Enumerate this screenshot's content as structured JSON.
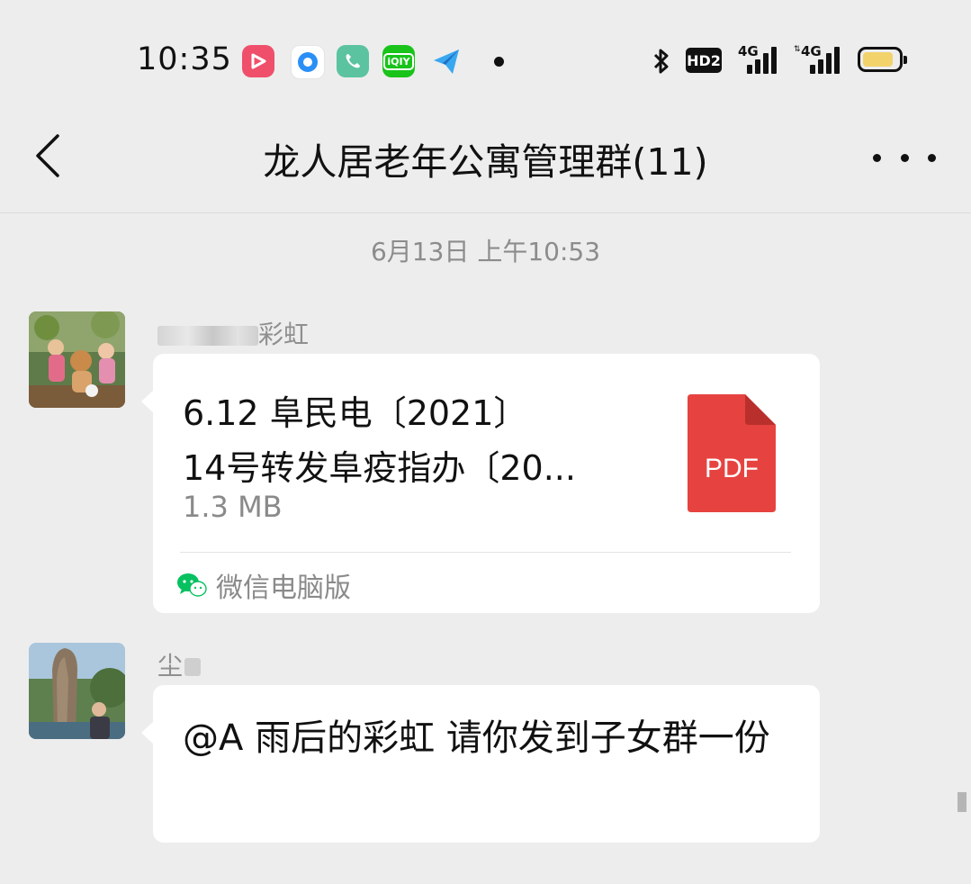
{
  "status_bar": {
    "time": "10:35",
    "apps": [
      {
        "icon": "video-app-icon",
        "color": "#ef4f6a",
        "glyph": "▶"
      },
      {
        "icon": "browser-app-icon",
        "color": "#ffffff",
        "glyph": ""
      },
      {
        "icon": "phone-app-icon",
        "color": "#5bc3a0",
        "glyph": "✆"
      },
      {
        "icon": "iqiyi-app-icon",
        "color": "#19c31a",
        "glyph": "iQIY"
      },
      {
        "icon": "paper-plane-app-icon",
        "color": "#38a7f0",
        "glyph": ""
      }
    ],
    "hd_label": "HD2",
    "signal1_label": "4G",
    "signal2_label": "4G",
    "battery_color": "#f2d36b"
  },
  "header": {
    "back_icon": "chevron-left-icon",
    "title": "龙人居老年公寓管理群(11)",
    "more_icon": "ellipsis-icon"
  },
  "chat": {
    "timestamp": "6月13日 上午10:53",
    "messages": [
      {
        "type": "file",
        "sender": "彩虹",
        "file_name_line1": "6.12 阜民电〔2021〕",
        "file_name_line2": "14号转发阜疫指办〔20...",
        "file_size": "1.3 MB",
        "file_icon_label": "PDF",
        "source": "微信电脑版"
      },
      {
        "type": "text",
        "sender": "尘",
        "text": "@A 雨后的彩虹  请你发到子女群一份"
      }
    ]
  },
  "colors": {
    "background": "#ededed",
    "bubble": "#ffffff",
    "pdf_red": "#e64340",
    "wechat_green": "#07c160"
  }
}
